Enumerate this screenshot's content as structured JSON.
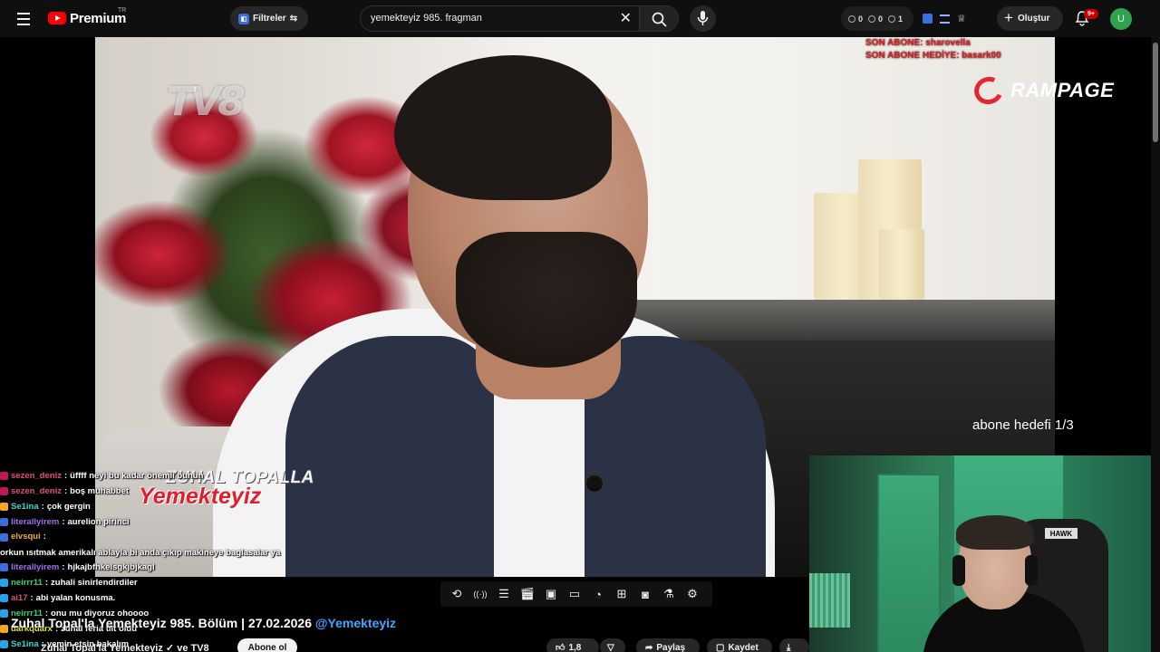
{
  "header": {
    "brand": "Premium",
    "country_code": "TR",
    "filters_label": "Filtreler",
    "search_value": "yemekteyiz 985. fragman",
    "stats": [
      "0",
      "0",
      "1"
    ],
    "create_label": "Oluştur",
    "notif_badge": "9+",
    "avatar_letter": "U"
  },
  "overlay": {
    "channel_logo": "TV8",
    "son_abone": "SON ABONE: sharovella",
    "son_abone_hediye": "SON ABONE HEDİYE: basark00",
    "sponsor": "RAMPAGE",
    "goal": "abone hedefi 1/3",
    "show_logo_line1": "ZUHAL TOPALLA",
    "show_logo_line2": "Yemekteyiz",
    "webcam_chair_brand": "HAWK"
  },
  "chat": [
    {
      "user": "sezen_deniz",
      "text": "üffff neyi bu kadar önemli bunun",
      "color": "#e14e7b",
      "icon": "#c2185b"
    },
    {
      "user": "sezen_deniz",
      "text": "boş muhabbet",
      "color": "#e14e7b",
      "icon": "#c2185b"
    },
    {
      "user": "Se1ina",
      "text": "çok gergin",
      "color": "#31d8d2",
      "icon": "#f5a623"
    },
    {
      "user": "literallyirem",
      "text": "aurelion pirinci",
      "color": "#a06cf0",
      "icon": "#3b6fd9"
    },
    {
      "user": "elvsqui",
      "text": "orkun ısıtmak amerikalı ablayla bi anda çıkıp makineye baglasalar ya",
      "color": "#f3b02e",
      "icon": "#3b6fd9"
    },
    {
      "user": "literallyirem",
      "text": "hjkajbfhkelsgkjbjkagl",
      "color": "#a06cf0",
      "icon": "#3b6fd9"
    },
    {
      "user": "neirrr11",
      "text": "zuhali sinirlendirdiler",
      "color": "#3bd16f",
      "icon": "#27a4e8"
    },
    {
      "user": "ai17",
      "text": "abi yalan konusma.",
      "color": "#e14e7b",
      "icon": "#27a4e8"
    },
    {
      "user": "neirrr11",
      "text": "onu mu diyoruz ohoooo",
      "color": "#3bd16f",
      "icon": "#27a4e8"
    },
    {
      "user": "darkquarx",
      "text": "zuhal feria tilt oldu",
      "color": "#e8e820",
      "icon": "#f5a623"
    },
    {
      "user": "Se1ina",
      "text": "yemin etsin bakalım",
      "color": "#31d8d2",
      "icon": "#27a4e8"
    }
  ],
  "video": {
    "title": "Zuhal Topal'la Yemekteyiz 985. Bölüm | 27.02.2026",
    "title_handle": "@Yemekteyiz",
    "channel": "Zuhal Topal'la Yemekteyiz ✓ ve TV8",
    "subscribe_label": "Abone ol",
    "like_count": "1,8",
    "share_label": "Paylaş",
    "save_label": "Kaydet"
  },
  "controls": [
    "repeat-icon",
    "broadcast-icon",
    "playlist-add-icon",
    "clapper-icon",
    "miniplayer-icon",
    "theater-icon",
    "speed-icon",
    "add-icon",
    "screenshot-icon",
    "lab-icon",
    "gear-icon"
  ]
}
